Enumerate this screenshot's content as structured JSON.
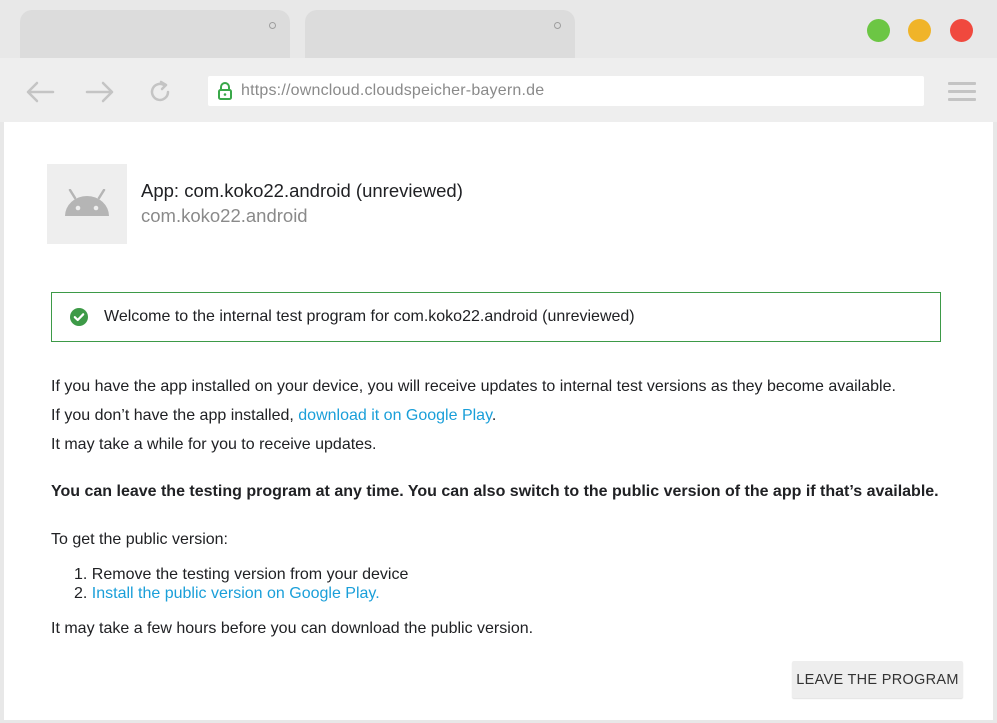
{
  "browser": {
    "url": "https://owncloud.cloudspeicher-bayern.de",
    "window_controls": {
      "green": "#6cc644",
      "yellow": "#f0b429",
      "red": "#f0493e"
    },
    "icons": [
      "back-arrow-icon",
      "forward-arrow-icon",
      "reload-icon",
      "lock-icon",
      "hamburger-menu-icon"
    ]
  },
  "app": {
    "title": "App: com.koko22.android (unreviewed)",
    "package": "com.koko22.android",
    "icon": "android-icon"
  },
  "welcome": {
    "text": "Welcome to the internal test program for com.koko22.android (unreviewed)",
    "icon": "check-circle-icon",
    "accent": "#3d9a47"
  },
  "info": {
    "line1": "If you have the app installed on your device, you will receive updates to internal test versions as they become available.",
    "line2_prefix": "If you don’t have the app installed, ",
    "line2_link": "download it on Google Play",
    "line2_suffix": ".",
    "line3": "It may take a while for you to receive updates."
  },
  "leave_notice": "You can leave the testing program at any time. You can also switch to the public version of the app if that’s available.",
  "public_version": {
    "heading": "To get the public version:",
    "steps": [
      {
        "number": "1.",
        "text": "Remove the testing version from your device"
      },
      {
        "number": "2.",
        "text": "Install the public version on Google Play."
      }
    ],
    "note": "It may take a few hours before you can download the public version."
  },
  "actions": {
    "leave_button": "LEAVE THE PROGRAM"
  },
  "colors": {
    "link": "#1a9fd9"
  }
}
